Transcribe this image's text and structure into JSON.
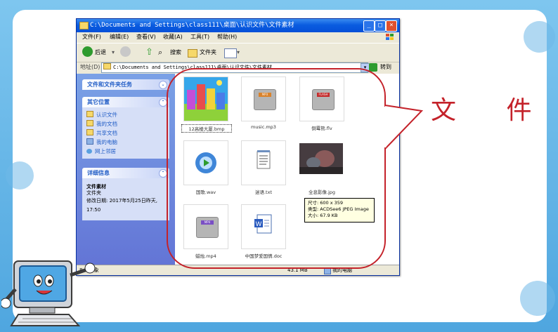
{
  "window": {
    "title": "C:\\Documents and Settings\\class111\\桌面\\认识文件\\文件素材",
    "menu": [
      "文件(F)",
      "编辑(E)",
      "查看(V)",
      "收藏(A)",
      "工具(T)",
      "帮助(H)"
    ],
    "toolbar": {
      "back": "后退",
      "search": "搜索",
      "folders": "文件夹"
    },
    "address": {
      "label": "地址(D)",
      "value": "C:\\Documents and Settings\\class111\\桌面\\认识文件\\文件素材",
      "go": "转到"
    }
  },
  "sidebar": {
    "tasks_title": "文件和文件夹任务",
    "other_title": "其它位置",
    "other_items": [
      "认识文件",
      "我的文档",
      "共享文档",
      "我的电脑",
      "网上邻居"
    ],
    "details_title": "详细信息",
    "details_name": "文件素材",
    "details_type": "文件夹",
    "details_modified": "修改日期: 2017年5月25日昨天, 17:50"
  },
  "files": [
    {
      "name": "12高楼大厦.bmp",
      "kind": "bmp"
    },
    {
      "name": "music.mp3",
      "kind": "mp3",
      "tag": "MP3"
    },
    {
      "name": "倒霉熊.flv",
      "kind": "flv",
      "tag": "FLASH"
    },
    {
      "name": "国歌.wav",
      "kind": "wav"
    },
    {
      "name": "迷语.txt",
      "kind": "txt"
    },
    {
      "name": "全息影像.jpg",
      "kind": "jpg"
    },
    {
      "name": "蜡烛.mp4",
      "kind": "mp4",
      "tag": "MP4"
    },
    {
      "name": "中国梦爱国情.doc",
      "kind": "doc"
    }
  ],
  "tooltip": {
    "dims": "尺寸: 600 x 359",
    "type": "类型: ACDSee6 JPEG Image",
    "size": "大小: 67.9 KB"
  },
  "status": {
    "count": "8 个对象",
    "size": "43.1 MB",
    "location": "我的电脑"
  },
  "annotation": "文 件",
  "colors": {
    "accent_red": "#c4222a",
    "xp_blue": "#0a5ce0",
    "sidebar_blue": "#6375d6"
  }
}
